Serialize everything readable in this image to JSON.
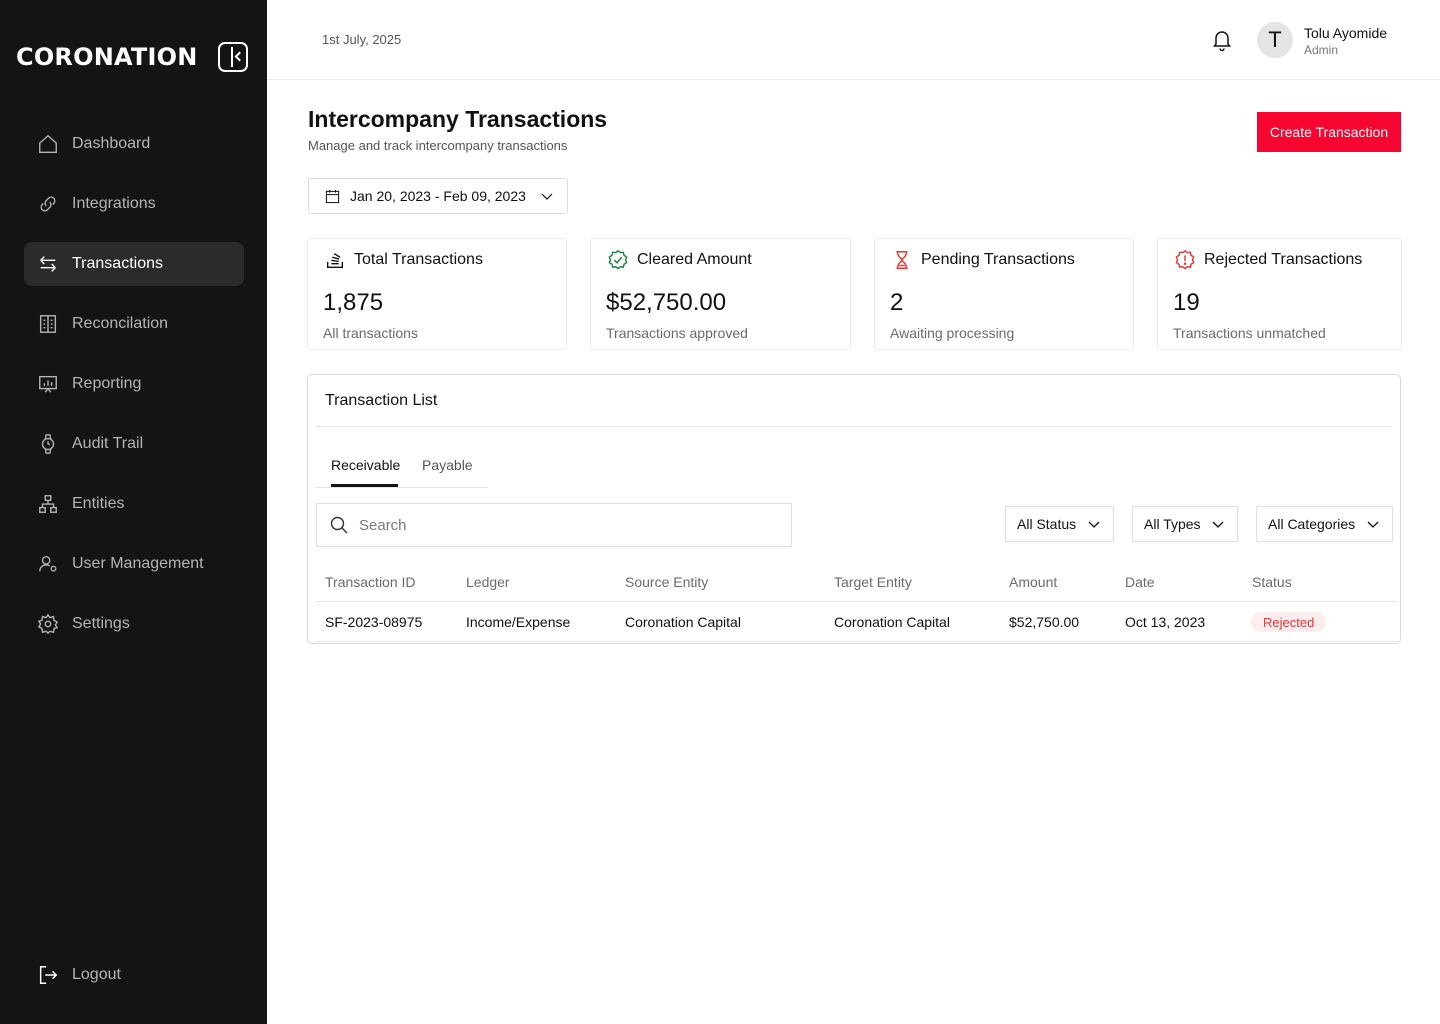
{
  "brand": {
    "name": "CORONATION"
  },
  "sidebar": {
    "items": [
      {
        "label": "Dashboard",
        "icon": "home-icon"
      },
      {
        "label": "Integrations",
        "icon": "link-icon"
      },
      {
        "label": "Transactions",
        "icon": "arrows-swap-icon"
      },
      {
        "label": "Reconcilation",
        "icon": "ledger-icon"
      },
      {
        "label": "Reporting",
        "icon": "presentation-chart-icon"
      },
      {
        "label": "Audit Trail",
        "icon": "watch-icon"
      },
      {
        "label": "Entities",
        "icon": "hierarchy-icon"
      },
      {
        "label": "User Management",
        "icon": "user-gear-icon"
      },
      {
        "label": "Settings",
        "icon": "gear-icon"
      }
    ],
    "active": "Transactions",
    "logout_label": "Logout"
  },
  "topbar": {
    "date": "1st July, 2025",
    "user": {
      "initial": "T",
      "name": "Tolu Ayomide",
      "role": "Admin"
    }
  },
  "header": {
    "title": "Intercompany Transactions",
    "subtitle": "Manage and track intercompany transactions",
    "create_label": "Create Transaction",
    "date_range": "Jan 20, 2023 - Feb 09, 2023"
  },
  "stats": [
    {
      "title": "Total Transactions",
      "value": "1,875",
      "note": "All transactions",
      "icon": "stack-icon",
      "color": "#111111"
    },
    {
      "title": "Cleared Amount",
      "value": "$52,750.00",
      "note": "Transactions approved",
      "icon": "verified-badge-icon",
      "color": "#1a8a3c"
    },
    {
      "title": "Pending Transactions",
      "value": "2",
      "note": "Awaiting processing",
      "icon": "hourglass-icon",
      "color": "#e53935"
    },
    {
      "title": "Rejected Transactions",
      "value": "19",
      "note": "Transactions unmatched",
      "icon": "alert-octagon-icon",
      "color": "#e53935"
    }
  ],
  "list": {
    "title": "Transaction List",
    "tabs": [
      "Receivable",
      "Payable"
    ],
    "active_tab": "Receivable",
    "search_placeholder": "Search",
    "filters": [
      "All Status",
      "All Types",
      "All Categories"
    ],
    "columns": [
      "Transaction ID",
      "Ledger",
      "Source Entity",
      "Target Entity",
      "Amount",
      "Date",
      "Status"
    ],
    "rows": [
      {
        "id": "SF-2023-08975",
        "ledger": "Income/Expense",
        "source": "Coronation Capital",
        "target": "Coronation Capital",
        "amount": "$52,750.00",
        "date": "Oct 13, 2023",
        "status": "Rejected"
      }
    ]
  }
}
